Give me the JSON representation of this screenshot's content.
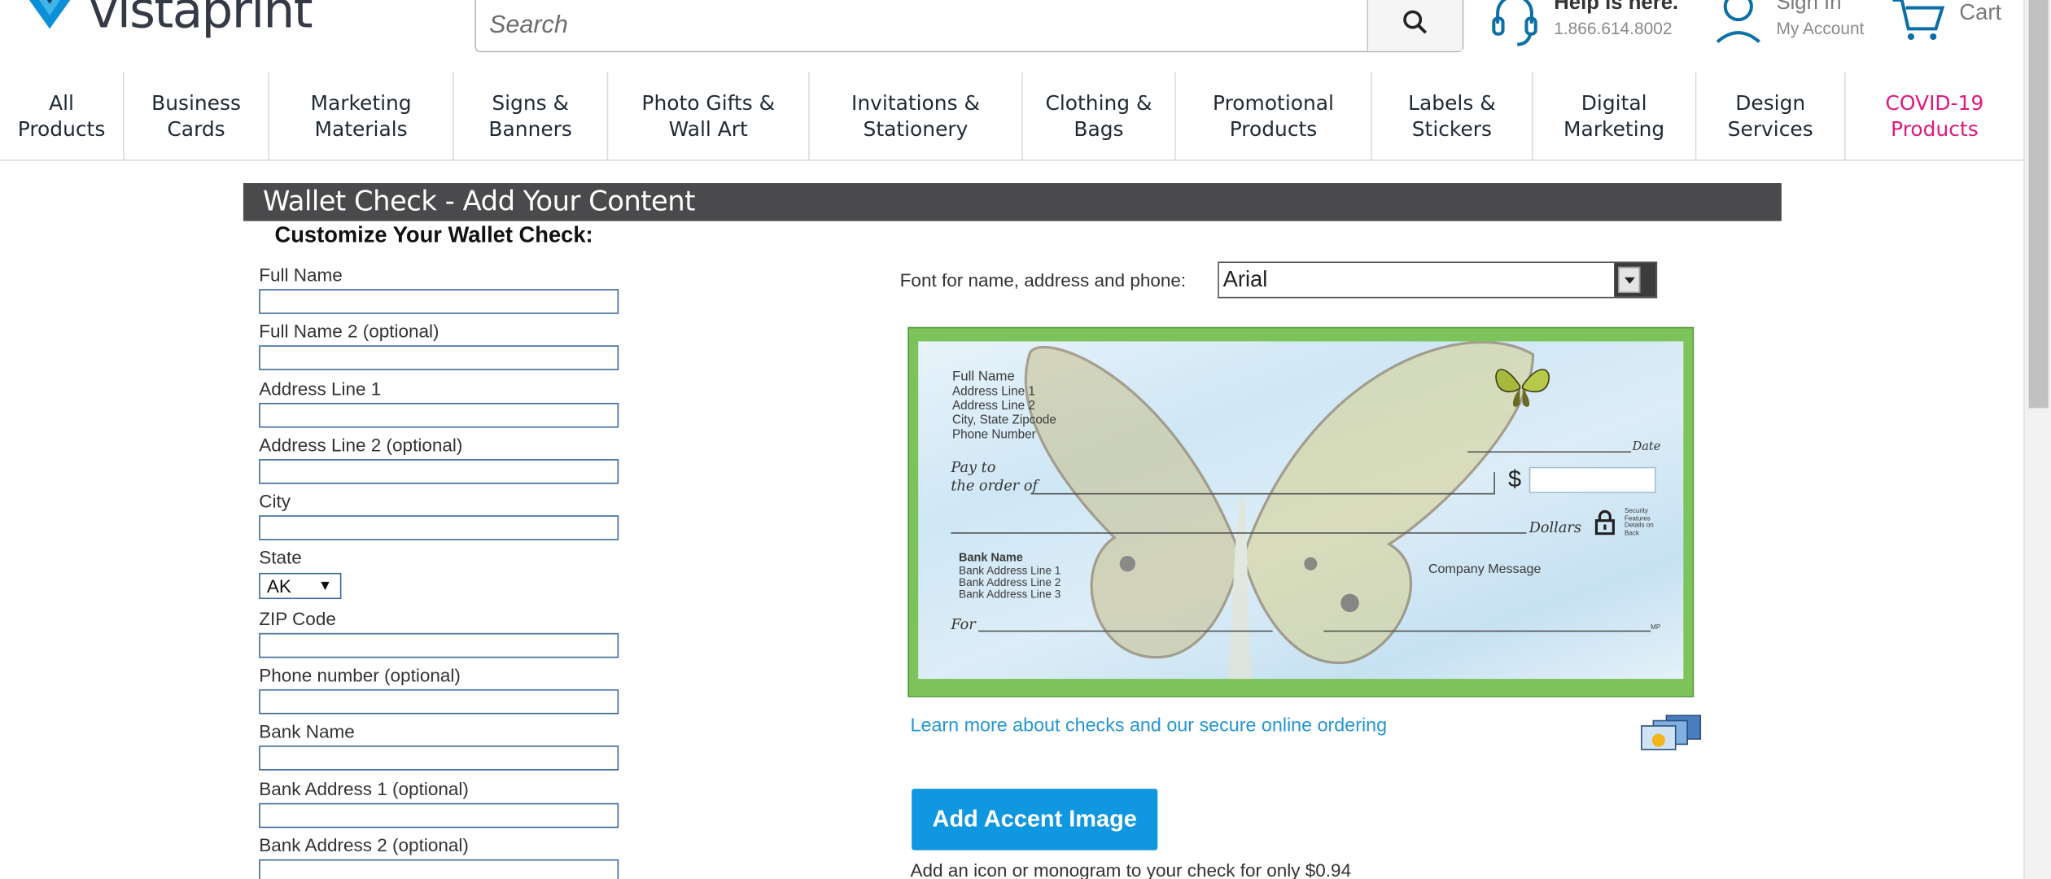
{
  "header": {
    "logo_text": "vistaprint",
    "search_placeholder": "Search",
    "help_title": "Help is here.",
    "help_phone": "1.866.614.8002",
    "sign_in": "Sign In",
    "my_account": "My Account",
    "cart": "Cart"
  },
  "nav": [
    {
      "line1": "All",
      "line2": "Products"
    },
    {
      "line1": "Business",
      "line2": "Cards"
    },
    {
      "line1": "Marketing",
      "line2": "Materials"
    },
    {
      "line1": "Signs &",
      "line2": "Banners"
    },
    {
      "line1": "Photo Gifts &",
      "line2": "Wall Art"
    },
    {
      "line1": "Invitations &",
      "line2": "Stationery"
    },
    {
      "line1": "Clothing &",
      "line2": "Bags"
    },
    {
      "line1": "Promotional",
      "line2": "Products"
    },
    {
      "line1": "Labels &",
      "line2": "Stickers"
    },
    {
      "line1": "Digital",
      "line2": "Marketing"
    },
    {
      "line1": "Design",
      "line2": "Services"
    },
    {
      "line1": "COVID-19",
      "line2": "Products"
    }
  ],
  "page": {
    "title": "Wallet Check - Add Your Content",
    "subtitle": "Customize Your Wallet Check:"
  },
  "form": {
    "full_name": "Full Name",
    "full_name2": "Full Name 2 (optional)",
    "address1": "Address Line 1",
    "address2": "Address Line 2 (optional)",
    "city": "City",
    "state": "State",
    "state_value": "AK",
    "zip": "ZIP Code",
    "phone": "Phone number (optional)",
    "bank_name": "Bank Name",
    "bank_address1": "Bank Address 1 (optional)",
    "bank_address2": "Bank Address 2 (optional)"
  },
  "font": {
    "label": "Font for name, address and phone:",
    "value": "Arial"
  },
  "check": {
    "full_name": "Full Name",
    "address1": "Address Line 1",
    "address2": "Address Line 2",
    "city_state": "City, State Zipcode",
    "phone": "Phone Number",
    "date": "Date",
    "pay_to": "Pay to",
    "order_of": "the order of",
    "dollar": "$",
    "dollars": "Dollars",
    "security": "Security Features Details on Back",
    "bank_name": "Bank Name",
    "bank_addr1": "Bank Address Line 1",
    "bank_addr2": "Bank Address Line 2",
    "bank_addr3": "Bank Address Line 3",
    "company_message": "Company Message",
    "for": "For",
    "mp": "MP"
  },
  "learn_more": "Learn more about checks and our secure online ordering",
  "accent": {
    "button": "Add Accent Image",
    "note": "Add an icon or monogram to your check for only $0.94"
  },
  "colors": {
    "brand_blue": "#0f97df",
    "link_blue": "#2596d2",
    "covid_pink": "#e0197d",
    "title_bar": "#4a4a4c"
  }
}
